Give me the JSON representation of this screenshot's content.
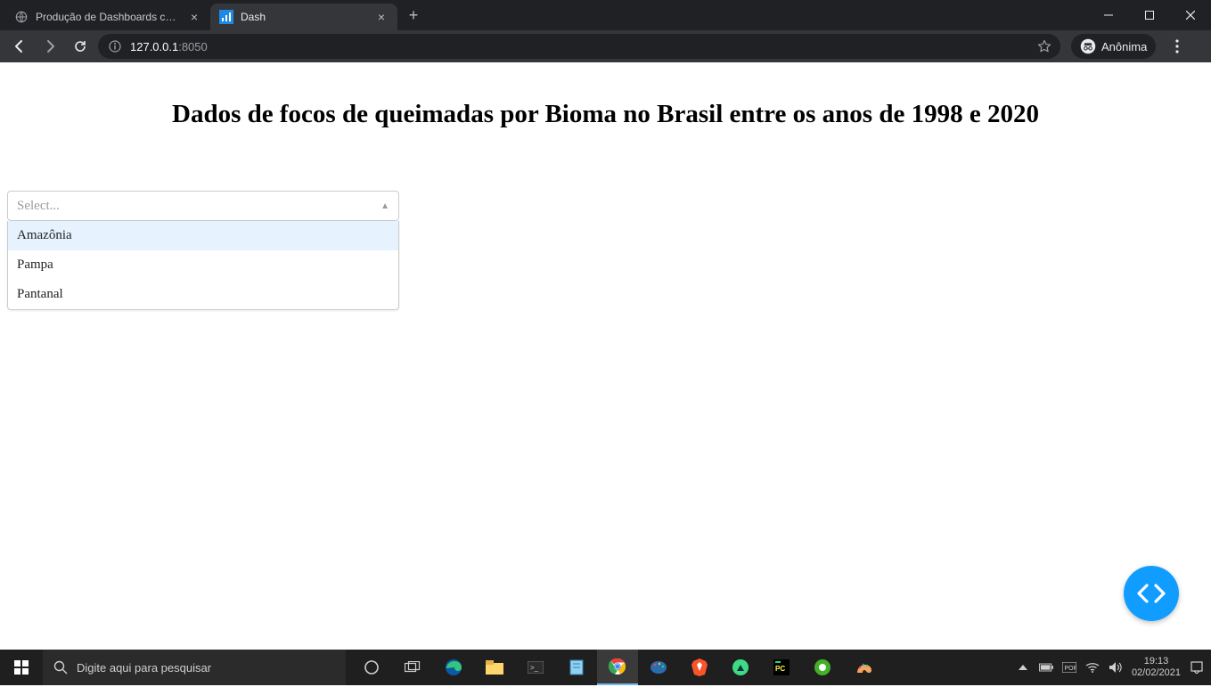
{
  "browser": {
    "tabs": [
      {
        "title": "Produção de Dashboards com Pl",
        "active": false
      },
      {
        "title": "Dash",
        "active": true
      }
    ],
    "url_host": "127.0.0.1",
    "url_port": ":8050",
    "incognito_label": "Anônima"
  },
  "page": {
    "heading": "Dados de focos de queimadas por Bioma no Brasil entre os anos de 1998 e 2020",
    "dropdown": {
      "placeholder": "Select...",
      "options": [
        "Amazônia",
        "Pampa",
        "Pantanal"
      ]
    }
  },
  "taskbar": {
    "search_placeholder": "Digite aqui para pesquisar",
    "time": "19:13",
    "date": "02/02/2021"
  }
}
